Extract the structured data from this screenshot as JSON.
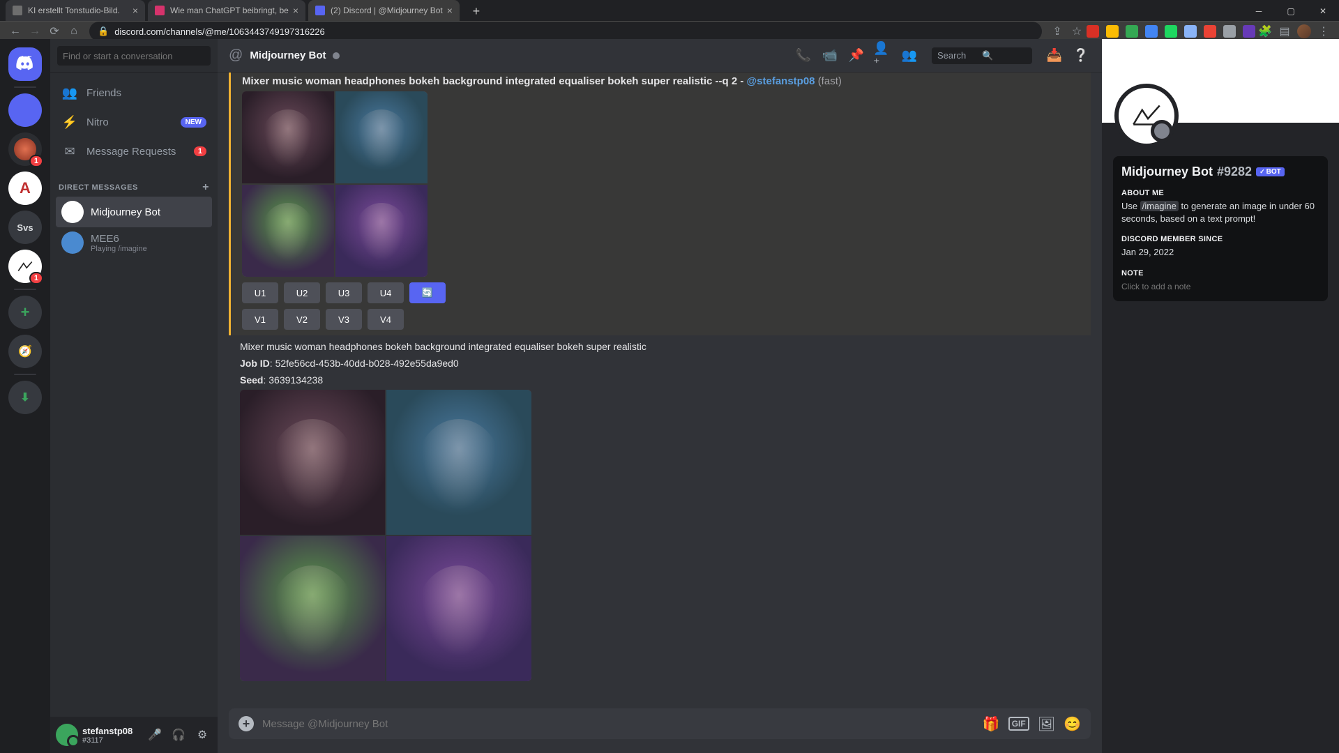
{
  "browser": {
    "tabs": [
      {
        "title": "KI erstellt Tonstudio-Bild.",
        "favicon": "#6e6e6e"
      },
      {
        "title": "Wie man ChatGPT beibringt, be",
        "favicon": "#d6336c"
      },
      {
        "title": "(2) Discord | @Midjourney Bot",
        "favicon": "#5865f2",
        "active": true
      }
    ],
    "url": "discord.com/channels/@me/1063443749197316226",
    "new_tab_glyph": "+"
  },
  "servers": [
    {
      "type": "home",
      "active": true,
      "badge": ""
    },
    {
      "type": "icon",
      "color": "#5865f2"
    },
    {
      "type": "icon",
      "color": "#e07050",
      "badge": "1"
    },
    {
      "type": "text",
      "label": "A",
      "color": "#fff",
      "bg": "#c03030"
    },
    {
      "type": "text",
      "label": "Svs",
      "color": "#dcddde"
    },
    {
      "type": "icon",
      "color": "#ffffff",
      "badge": "1"
    },
    {
      "type": "add"
    },
    {
      "type": "explore"
    },
    {
      "type": "download"
    }
  ],
  "sidebar": {
    "search_placeholder": "Find or start a conversation",
    "friends": "Friends",
    "nitro": "Nitro",
    "nitro_badge": "NEW",
    "requests": "Message Requests",
    "requests_count": "1",
    "dm_header": "DIRECT MESSAGES",
    "dms": [
      {
        "name": "Midjourney Bot",
        "selected": true
      },
      {
        "name": "MEE6",
        "sub": "Playing /imagine"
      }
    ]
  },
  "user": {
    "name": "stefanstp08",
    "tag": "#3117"
  },
  "chat": {
    "title": "Midjourney Bot",
    "search_placeholder": "Search",
    "msg1_prompt": "Mixer music woman headphones bokeh background integrated equaliser bokeh super realistic --q 2",
    "msg1_mention": "@stefanstp08",
    "msg1_meta": "(fast)",
    "u_buttons": [
      "U1",
      "U2",
      "U3",
      "U4"
    ],
    "v_buttons": [
      "V1",
      "V2",
      "V3",
      "V4"
    ],
    "refresh_glyph": "🔄",
    "msg2_prompt": "Mixer music woman headphones bokeh background integrated equaliser bokeh super realistic",
    "job_label": "Job ID",
    "job_id": "52fe56cd-453b-40dd-b028-492e55da9ed0",
    "seed_label": "Seed",
    "seed": "3639134238",
    "input_placeholder": "Message @Midjourney Bot"
  },
  "profile": {
    "name": "Midjourney Bot",
    "discrim": "#9282",
    "bot_label": "BOT",
    "about_header": "ABOUT ME",
    "about_pre": "Use ",
    "about_cmd": "/imagine",
    "about_post": " to generate an image in under 60 seconds, based on a text prompt!",
    "member_header": "DISCORD MEMBER SINCE",
    "member_since": "Jan 29, 2022",
    "note_header": "NOTE",
    "note_placeholder": "Click to add a note"
  }
}
